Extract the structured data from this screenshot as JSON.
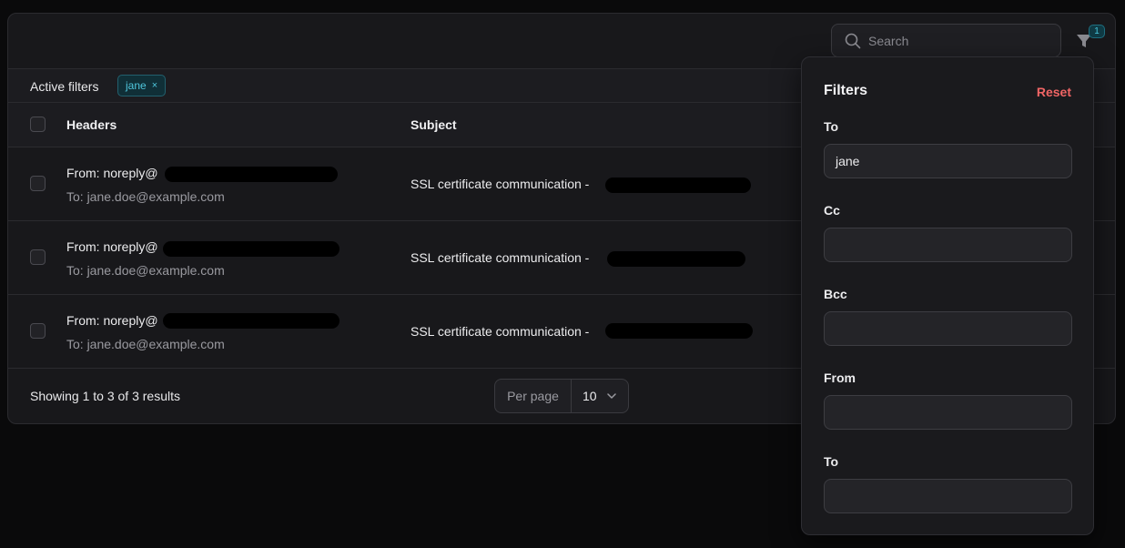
{
  "toolbar": {
    "search_placeholder": "Search",
    "filter_count": "1"
  },
  "active_filters": {
    "label": "Active filters",
    "chips": [
      {
        "label": "jane",
        "remove": "×"
      }
    ]
  },
  "table": {
    "columns": [
      "Headers",
      "Subject"
    ],
    "rows": [
      {
        "from": "From: noreply@",
        "to": "To: jane.doe@example.com",
        "subject": "SSL certificate communication -"
      },
      {
        "from": "From: noreply@",
        "to": "To: jane.doe@example.com",
        "subject": "SSL certificate communication -"
      },
      {
        "from": "From: noreply@",
        "to": "To: jane.doe@example.com",
        "subject": "SSL certificate communication -"
      }
    ]
  },
  "footer": {
    "summary": "Showing 1 to 3 of 3 results",
    "per_page_label": "Per page",
    "per_page_value": "10"
  },
  "filters_panel": {
    "title": "Filters",
    "reset": "Reset",
    "fields": [
      {
        "label": "To",
        "value": "jane"
      },
      {
        "label": "Cc",
        "value": ""
      },
      {
        "label": "Bcc",
        "value": ""
      },
      {
        "label": "From",
        "value": ""
      },
      {
        "label": "To",
        "value": ""
      }
    ]
  },
  "colors": {
    "accent": "#4fc6dc",
    "reset": "#f06565",
    "background": "#0a0a0b"
  }
}
